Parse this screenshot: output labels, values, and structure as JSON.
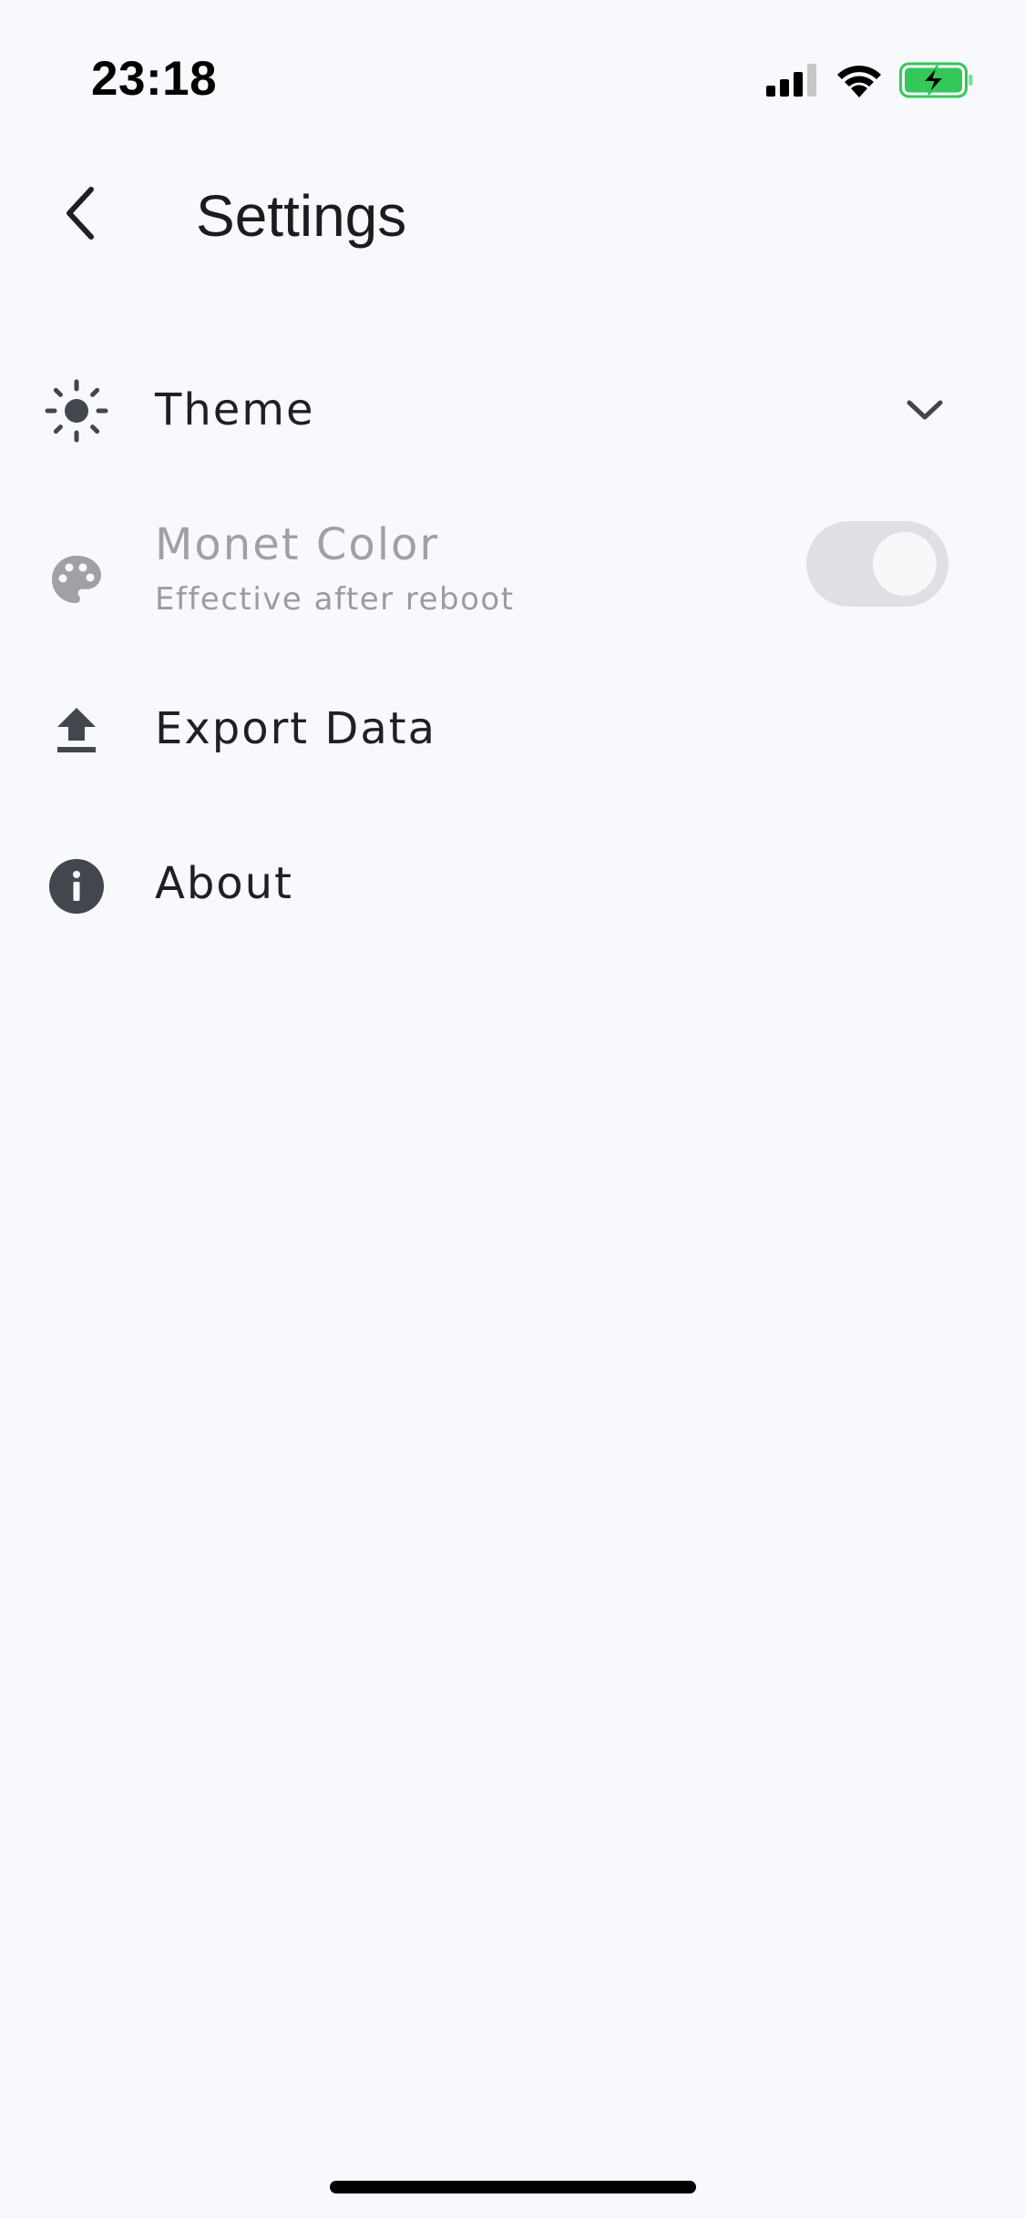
{
  "status_bar": {
    "time": "23:18",
    "signal_icon": "cellular-signal-icon",
    "wifi_icon": "wifi-icon",
    "battery_icon": "battery-charging-icon",
    "battery_color": "#34c759"
  },
  "header": {
    "back_icon": "chevron-left-icon",
    "title": "Settings"
  },
  "settings": {
    "theme": {
      "icon": "brightness-icon",
      "label": "Theme",
      "expand_icon": "chevron-down-icon"
    },
    "monet_color": {
      "icon": "palette-icon",
      "label": "Monet Color",
      "subtitle": "Effective after reboot",
      "enabled": false,
      "toggle_on": true
    },
    "export_data": {
      "icon": "upload-icon",
      "label": "Export Data"
    },
    "about": {
      "icon": "info-icon",
      "label": "About"
    }
  },
  "colors": {
    "background": "#f7f9fd",
    "icon": "#43464d",
    "disabled": "#9fa1a6",
    "text": "#1f2024"
  }
}
